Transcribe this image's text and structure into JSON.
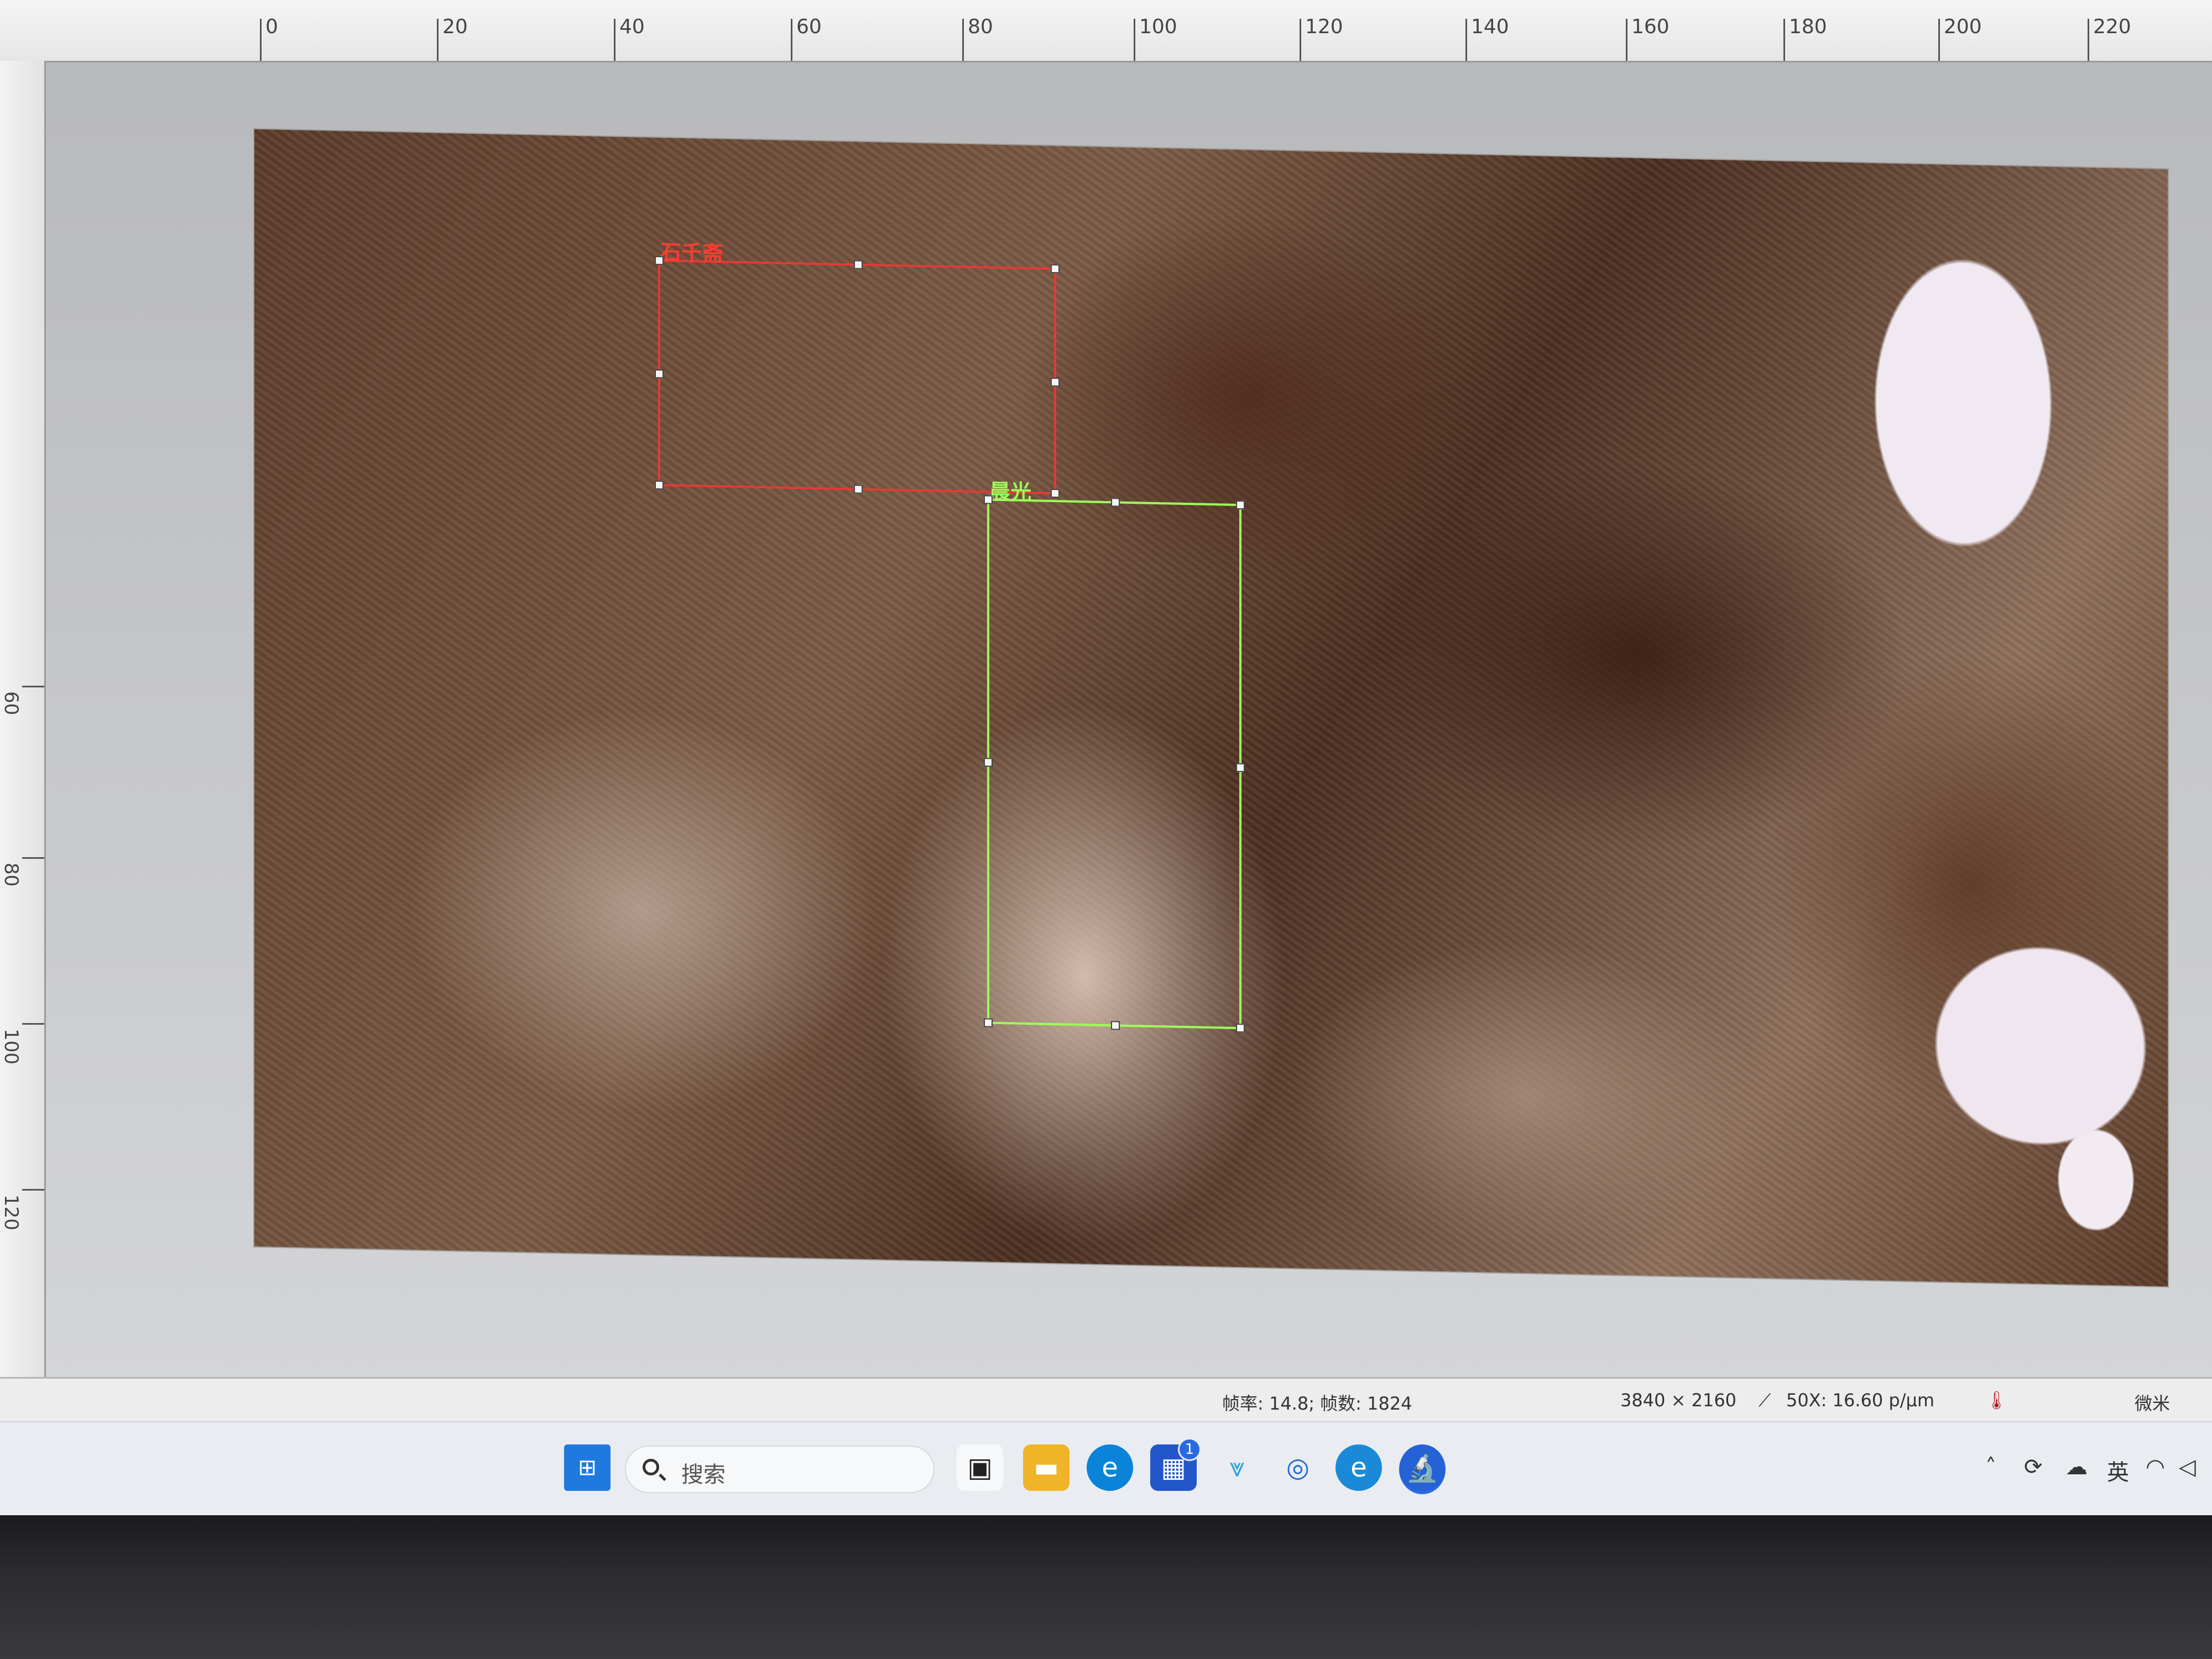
{
  "ruler": {
    "top_labels": [
      "0",
      "20",
      "40",
      "60",
      "80",
      "100",
      "120",
      "140",
      "160",
      "180",
      "200",
      "220"
    ],
    "left_labels": [
      "60",
      "80",
      "100",
      "120"
    ]
  },
  "annotations": {
    "red_label": "石千斋",
    "green_label": "晨光"
  },
  "status": {
    "frame_info": "帧率: 14.8; 帧数: 1824",
    "resolution": "3840 × 2160",
    "calibration": "50X: 16.60 p/μm",
    "unit": "微米"
  },
  "taskbar": {
    "search_placeholder": "搜索",
    "badge_count": "1",
    "ime_label": "英"
  },
  "colors": {
    "roi_red": "#e53935",
    "roi_green": "#9cff57"
  }
}
